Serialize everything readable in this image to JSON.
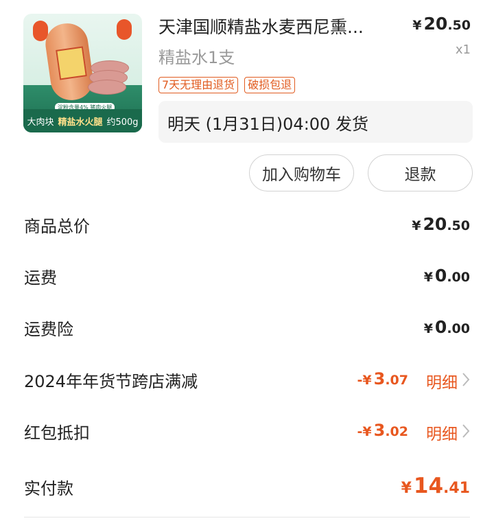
{
  "product": {
    "image_texts": {
      "note": "淀粉含量4% 猪肉火腿",
      "banner_left": "大肉块",
      "banner_main": "精盐水火腿",
      "banner_right": "约500g"
    },
    "title": "天津国顺精盐水麦西尼熏...",
    "price_currency": "¥",
    "price_int": "20",
    "price_dec": ".50",
    "spec": "精盐水1支",
    "quantity": "x1",
    "tags": [
      "7天无理由退货",
      "破损包退"
    ],
    "shipping": "明天 (1月31日)04:00 发货"
  },
  "actions": {
    "cart_label": "加入购物车",
    "refund_label": "退款"
  },
  "summary": {
    "rows": [
      {
        "label": "商品总价",
        "currency": "¥",
        "int": "20",
        "dec": ".50"
      },
      {
        "label": "运费",
        "currency": "¥",
        "int": "0",
        "dec": ".00"
      },
      {
        "label": "运费险",
        "currency": "¥",
        "int": "0",
        "dec": ".00"
      },
      {
        "label": "2024年年货节跨店满减",
        "currency": "-¥",
        "int": "3",
        "dec": ".07",
        "detail": "明细"
      },
      {
        "label": "红包抵扣",
        "currency": "-¥",
        "int": "3",
        "dec": ".02",
        "detail": "明细"
      }
    ],
    "total": {
      "label": "实付款",
      "currency": "¥",
      "int": "14",
      "dec": ".41"
    }
  },
  "colors": {
    "accent": "#e8571f",
    "tag": "#e15b1f",
    "banner": "#1a6a4c"
  }
}
